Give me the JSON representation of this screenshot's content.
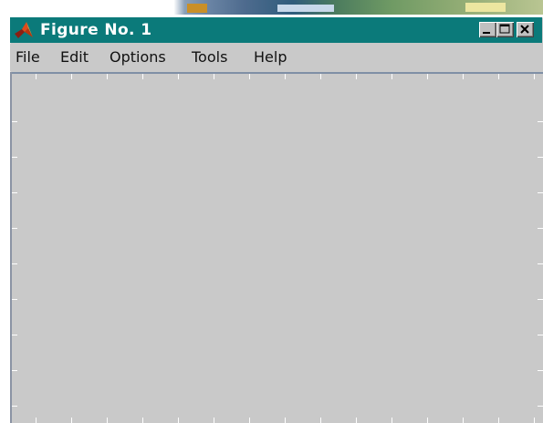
{
  "window": {
    "title": "Figure No. 1",
    "title_bar_color": "#0b7a7a",
    "icon": "matlab-logo-icon",
    "controls": [
      "minimize-icon",
      "maximize-icon",
      "close-icon"
    ]
  },
  "menubar": {
    "items": [
      "File",
      "Edit",
      "Options",
      "Tools",
      "Help"
    ]
  },
  "axes": {
    "background": "#c9c9c9",
    "tick_color": "#ffffff"
  }
}
